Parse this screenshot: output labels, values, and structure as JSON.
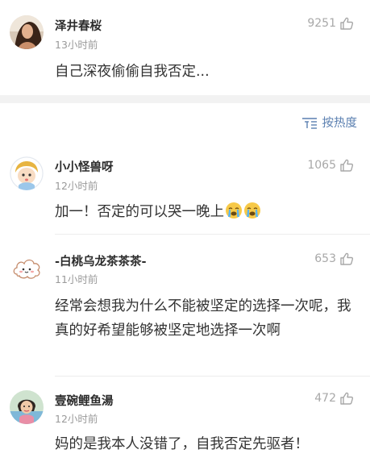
{
  "top_comment": {
    "username": "泽井春桜",
    "time": "13小时前",
    "likes": "9251",
    "text": "自己深夜偷偷自我否定..."
  },
  "sort": {
    "label": "按热度"
  },
  "comments": [
    {
      "username": "小小怪兽呀",
      "time": "12小时前",
      "likes": "1065",
      "text": "加一！否定的可以哭一晚上"
    },
    {
      "username": "-白桃乌龙茶茶茶-",
      "time": "11小时前",
      "likes": "653",
      "text": "经常会想我为什么不能被坚定的选择一次呢，我真的好希望能够被坚定地选择一次啊"
    },
    {
      "username": "壹碗鲤鱼湯",
      "time": "12小时前",
      "likes": "472",
      "text": "妈的是我本人没错了，自我否定先驱者！"
    }
  ],
  "colors": {
    "link_blue": "#5a7fb0",
    "muted": "#9a9a9a",
    "separator": "#f2f2f2"
  },
  "icons": {
    "like": "thumbs-up-icon",
    "sort": "sort-lines-icon",
    "emoji": "crying-face-icon"
  }
}
